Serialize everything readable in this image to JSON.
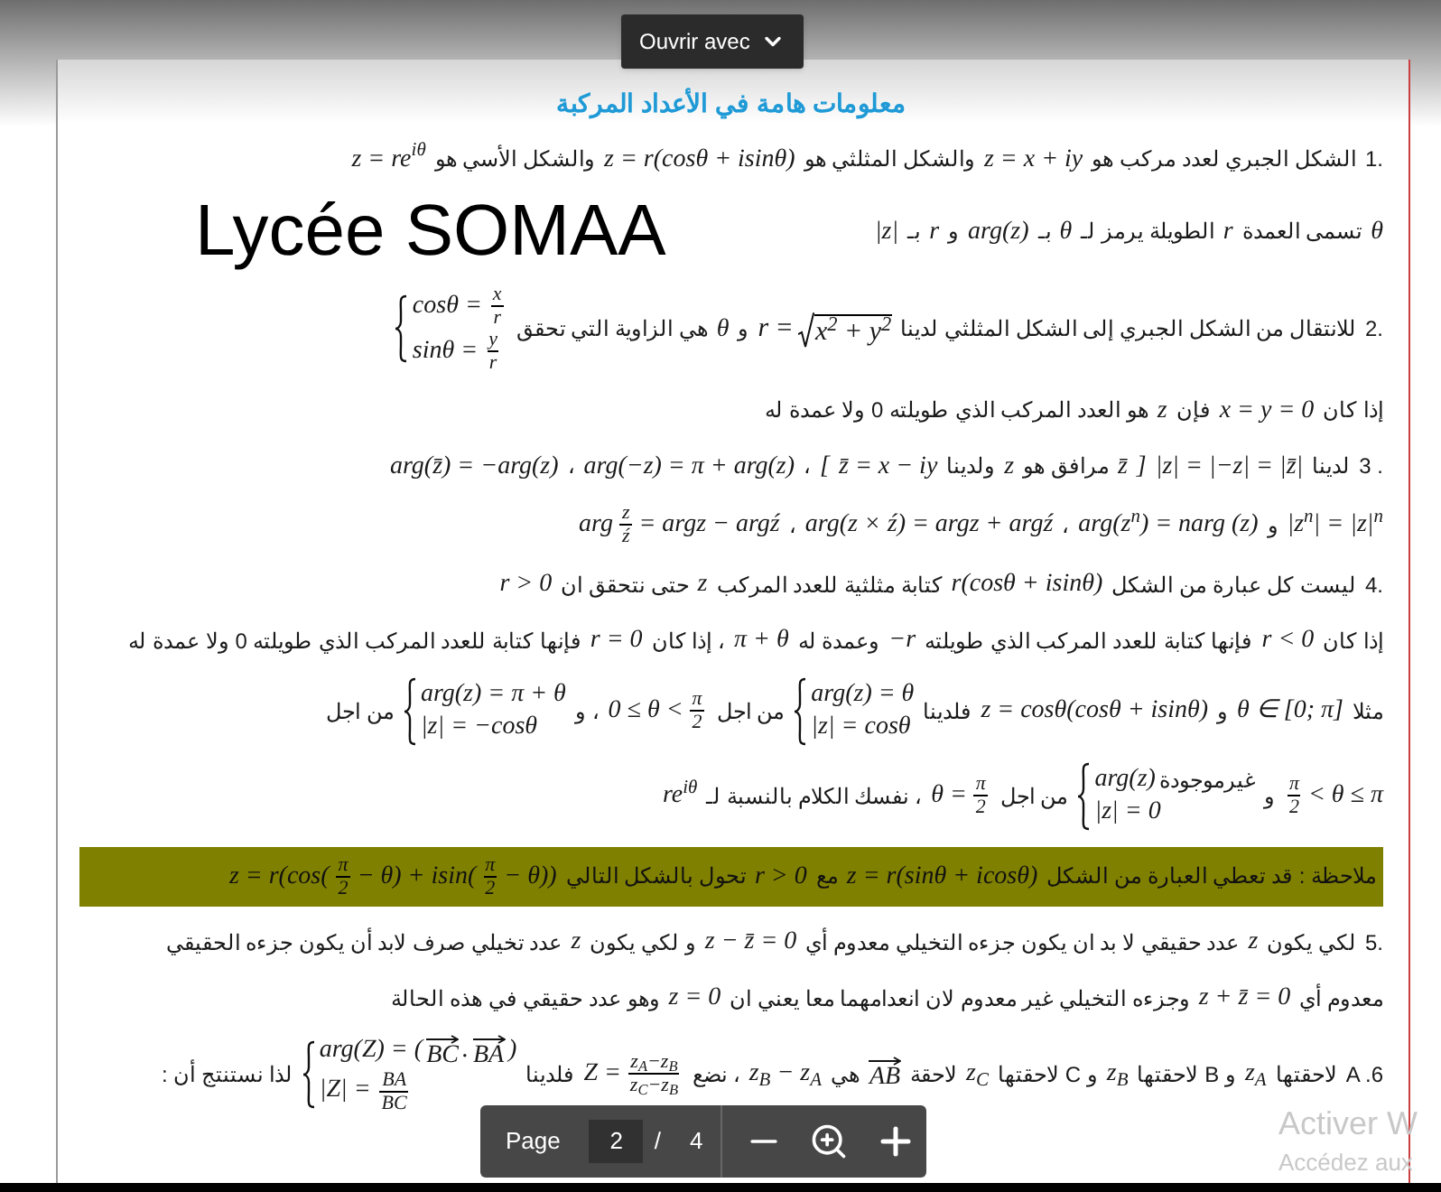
{
  "toolbar": {
    "open_with": "Ouvrir avec"
  },
  "document": {
    "lines": [
      {
        "kind": "title",
        "parts": [
          {
            "kind": "ar",
            "text": "معلومات هامة في الأعداد المركبة"
          }
        ]
      },
      {
        "kind": "para",
        "parts": [
          {
            "kind": "label",
            "text": "1."
          },
          {
            "kind": "ar",
            "text": "الشكل الجبري لعدد مركب هو"
          },
          {
            "kind": "math",
            "text": "z = x + iy"
          },
          {
            "kind": "ar",
            "text": "والشكل المثلثي هو"
          },
          {
            "kind": "math",
            "text": "z = r(cosθ + isinθ)"
          },
          {
            "kind": "ar",
            "text": "والشكل الأسي هو"
          },
          {
            "kind": "math",
            "text": "z = re$^{iθ}$"
          }
        ]
      },
      {
        "kind": "para",
        "aside": "Lycée SOMAA",
        "parts": [
          {
            "kind": "math",
            "text": "θ"
          },
          {
            "kind": "ar",
            "text": "تسمى العمدة"
          },
          {
            "kind": "math",
            "text": "r"
          },
          {
            "kind": "ar",
            "text": "الطويلة يرمز لـ"
          },
          {
            "kind": "math",
            "text": "θ"
          },
          {
            "kind": "ar",
            "text": "بـ"
          },
          {
            "kind": "math",
            "text": "arg(z)"
          },
          {
            "kind": "ar",
            "text": "و"
          },
          {
            "kind": "math",
            "text": "r"
          },
          {
            "kind": "ar",
            "text": "بـ"
          },
          {
            "kind": "math",
            "text": "|z|"
          }
        ]
      },
      {
        "kind": "para",
        "parts": [
          {
            "kind": "label",
            "text": "2."
          },
          {
            "kind": "ar",
            "text": "للانتقال من الشكل الجبري إلى الشكل المثلثي لدينا"
          },
          {
            "kind": "sqrt",
            "lhs": "r =",
            "radicand": "x$^{2}$ + y$^{2}$"
          },
          {
            "kind": "ar",
            "text": "و"
          },
          {
            "kind": "math",
            "text": "θ"
          },
          {
            "kind": "ar",
            "text": "هي الزاوية التي تحقق"
          },
          {
            "kind": "system",
            "rows": [
              [
                {
                  "kind": "frac",
                  "num": "x",
                  "den": "r"
                },
                {
                  "kind": "math",
                  "text": "cosθ ="
                }
              ],
              [
                {
                  "kind": "frac",
                  "num": "y",
                  "den": "r"
                },
                {
                  "kind": "math",
                  "text": "sinθ ="
                }
              ]
            ]
          }
        ]
      },
      {
        "kind": "para",
        "parts": [
          {
            "kind": "ar",
            "text": "إذا كان"
          },
          {
            "kind": "math",
            "text": "x = y = 0"
          },
          {
            "kind": "ar",
            "text": "فإن"
          },
          {
            "kind": "math",
            "text": "z"
          },
          {
            "kind": "ar",
            "text": "هو العدد المركب الذي طويلته 0 ولا عمدة له"
          }
        ]
      },
      {
        "kind": "para",
        "parts": [
          {
            "kind": "label",
            "text": "3 ."
          },
          {
            "kind": "ar",
            "text": "لدينا"
          },
          {
            "kind": "math",
            "text": "|z| = |−z| = |z̄|"
          },
          {
            "kind": "math",
            "text": "]"
          },
          {
            "kind": "math",
            "text": "z̄"
          },
          {
            "kind": "ar",
            "text": "مرافق هو"
          },
          {
            "kind": "math",
            "text": "z"
          },
          {
            "kind": "ar",
            "text": "ولدينا"
          },
          {
            "kind": "math",
            "text": "z̄ = x − iy"
          },
          {
            "kind": "math",
            "text": "["
          },
          {
            "kind": "ar",
            "text": "،"
          },
          {
            "kind": "math",
            "text": "arg(−z) = π + arg(z)"
          },
          {
            "kind": "ar",
            "text": "،"
          },
          {
            "kind": "math",
            "text": "arg(z̄) = −arg(z)"
          }
        ]
      },
      {
        "kind": "para",
        "parts": [
          {
            "kind": "math",
            "text": "|z$^{n}$| = |z|$^{n}$"
          },
          {
            "kind": "ar",
            "text": "و"
          },
          {
            "kind": "math",
            "text": "arg(z$^{n}$) = narg (z)"
          },
          {
            "kind": "ar",
            "text": "،"
          },
          {
            "kind": "math",
            "text": "arg(z × ź) = argz + argź"
          },
          {
            "kind": "ar",
            "text": "،"
          },
          {
            "kind": "expr",
            "items": [
              {
                "kind": "math",
                "text": "= argz − argź"
              },
              {
                "kind": "frac",
                "num": "z",
                "den": "ź"
              },
              {
                "kind": "math",
                "text": "arg"
              }
            ]
          }
        ]
      },
      {
        "kind": "para",
        "parts": [
          {
            "kind": "label",
            "text": "4."
          },
          {
            "kind": "ar",
            "text": "ليست كل عبارة من الشكل"
          },
          {
            "kind": "math",
            "text": "r(cosθ + isinθ)"
          },
          {
            "kind": "ar",
            "text": "كتابة مثلثية للعدد المركب"
          },
          {
            "kind": "math",
            "text": "z"
          },
          {
            "kind": "ar",
            "text": "حتى نتحقق ان"
          },
          {
            "kind": "math",
            "text": "r > 0"
          }
        ]
      },
      {
        "kind": "para",
        "parts": [
          {
            "kind": "ar",
            "text": "إذا كان"
          },
          {
            "kind": "math",
            "text": "r < 0"
          },
          {
            "kind": "ar",
            "text": "فإنها كتابة للعدد المركب الذي طويلته"
          },
          {
            "kind": "math",
            "text": "−r"
          },
          {
            "kind": "ar",
            "text": "وعمدة له"
          },
          {
            "kind": "math",
            "text": "π + θ"
          },
          {
            "kind": "ar",
            "text": "، إذا كان"
          },
          {
            "kind": "math",
            "text": "r = 0"
          },
          {
            "kind": "ar",
            "text": "فإنها كتابة للعدد المركب الذي طويلته 0 ولا عمدة له"
          }
        ]
      },
      {
        "kind": "para",
        "parts": [
          {
            "kind": "ar",
            "text": "مثلا"
          },
          {
            "kind": "math",
            "text": "θ ∈ [0; π]"
          },
          {
            "kind": "ar",
            "text": "و"
          },
          {
            "kind": "math",
            "text": "z = cosθ(cosθ + isinθ)"
          },
          {
            "kind": "ar",
            "text": "فلدينا"
          },
          {
            "kind": "system",
            "rows": [
              [
                {
                  "kind": "math",
                  "text": "arg(z) = θ"
                }
              ],
              [
                {
                  "kind": "math",
                  "text": "|z| = cosθ"
                }
              ]
            ]
          },
          {
            "kind": "ar",
            "text": "من اجل"
          },
          {
            "kind": "expr",
            "items": [
              {
                "kind": "frac",
                "num": "π",
                "den": "2"
              },
              {
                "kind": "math",
                "text": "0 ≤ θ <"
              }
            ]
          },
          {
            "kind": "ar",
            "text": "، و"
          },
          {
            "kind": "system",
            "rows": [
              [
                {
                  "kind": "math",
                  "text": "arg(z) = π + θ"
                }
              ],
              [
                {
                  "kind": "math",
                  "text": "|z| = −cosθ"
                }
              ]
            ]
          },
          {
            "kind": "ar",
            "text": "من اجل"
          }
        ]
      },
      {
        "kind": "para",
        "parts": [
          {
            "kind": "expr",
            "items": [
              {
                "kind": "math",
                "text": "< θ ≤ π"
              },
              {
                "kind": "frac",
                "num": "π",
                "den": "2"
              }
            ]
          },
          {
            "kind": "ar",
            "text": "و"
          },
          {
            "kind": "system",
            "rows": [
              [
                {
                  "kind": "expr",
                  "items": [
                    {
                      "kind": "ar",
                      "text": "غيرموجودة"
                    },
                    {
                      "kind": "math",
                      "text": "arg(z)"
                    }
                  ]
                }
              ],
              [
                {
                  "kind": "math",
                  "text": "|z| = 0"
                }
              ]
            ]
          },
          {
            "kind": "ar",
            "text": "من اجل"
          },
          {
            "kind": "expr",
            "items": [
              {
                "kind": "frac",
                "num": "π",
                "den": "2"
              },
              {
                "kind": "math",
                "text": "θ ="
              }
            ]
          },
          {
            "kind": "ar",
            "text": "، نفسك الكلام بالنسبة لـ"
          },
          {
            "kind": "math",
            "text": "re$^{iθ}$"
          }
        ]
      },
      {
        "kind": "note",
        "parts": [
          {
            "kind": "ar",
            "text": "ملاحظة : قد تعطي العبارة من الشكل"
          },
          {
            "kind": "math",
            "text": "z = r(sinθ + icosθ)"
          },
          {
            "kind": "ar",
            "text": "مع"
          },
          {
            "kind": "math",
            "text": "r > 0"
          },
          {
            "kind": "ar",
            "text": "تحول بالشكل التالي"
          },
          {
            "kind": "expr",
            "items": [
              {
                "kind": "math",
                "text": "− θ))"
              },
              {
                "kind": "frac",
                "num": "π",
                "den": "2"
              },
              {
                "kind": "math",
                "text": "− θ) + isin("
              },
              {
                "kind": "frac",
                "num": "π",
                "den": "2"
              },
              {
                "kind": "math",
                "text": "z = r(cos("
              }
            ]
          }
        ]
      },
      {
        "kind": "para",
        "parts": [
          {
            "kind": "label",
            "text": "5."
          },
          {
            "kind": "ar",
            "text": "لكي يكون"
          },
          {
            "kind": "math",
            "text": "z"
          },
          {
            "kind": "ar",
            "text": "عدد حقيقي لا بد ان يكون جزءه التخيلي معدوم أي"
          },
          {
            "kind": "math",
            "text": "z − z̄ = 0"
          },
          {
            "kind": "ar",
            "text": "و لكي يكون"
          },
          {
            "kind": "math",
            "text": "z"
          },
          {
            "kind": "ar",
            "text": "عدد تخيلي صرف لابد أن يكون جزءه الحقيقي"
          }
        ]
      },
      {
        "kind": "para",
        "parts": [
          {
            "kind": "ar",
            "text": "معدوم أي"
          },
          {
            "kind": "math",
            "text": "z + z̄ = 0"
          },
          {
            "kind": "ar",
            "text": "وجزءه التخيلي غير معدوم لان انعدامهما معا يعني ان"
          },
          {
            "kind": "math",
            "text": "z = 0"
          },
          {
            "kind": "ar",
            "text": "وهو عدد حقيقي في هذه الحالة"
          }
        ]
      },
      {
        "kind": "para",
        "parts": [
          {
            "kind": "label",
            "text": "A .6"
          },
          {
            "kind": "ar",
            "text": "لاحقتها"
          },
          {
            "kind": "math",
            "text": "z$_{A}$"
          },
          {
            "kind": "ar",
            "text": "و B لاحقتها"
          },
          {
            "kind": "math",
            "text": "z$_{B}$"
          },
          {
            "kind": "ar",
            "text": "و C لاحقتها"
          },
          {
            "kind": "math",
            "text": "z$_{C}$"
          },
          {
            "kind": "ar",
            "text": "لاحقة"
          },
          {
            "kind": "vec",
            "text": "AB"
          },
          {
            "kind": "ar",
            "text": "هي"
          },
          {
            "kind": "math",
            "text": "z$_{B}$ − z$_{A}$"
          },
          {
            "kind": "ar",
            "text": "، نضع"
          },
          {
            "kind": "expr",
            "items": [
              {
                "kind": "frac",
                "num": "z$_{A}$−z$_{B}$",
                "den": "z$_{C}$−z$_{B}$"
              },
              {
                "kind": "math",
                "text": "Z ="
              }
            ]
          },
          {
            "kind": "ar",
            "text": "فلدينا"
          },
          {
            "kind": "system",
            "rows": [
              [
                {
                  "kind": "expr",
                  "items": [
                    {
                      "kind": "math",
                      "text": ")"
                    },
                    {
                      "kind": "vec",
                      "text": "BA"
                    },
                    {
                      "kind": "math",
                      "text": "."
                    },
                    {
                      "kind": "vec",
                      "text": "BC"
                    },
                    {
                      "kind": "math",
                      "text": "arg(Z) = ("
                    }
                  ]
                }
              ],
              [
                {
                  "kind": "frac",
                  "num": "BA",
                  "den": "BC"
                },
                {
                  "kind": "math",
                  "text": "|Z| ="
                }
              ]
            ]
          },
          {
            "kind": "ar",
            "text": "لذا نستنتج أن :"
          }
        ]
      }
    ]
  },
  "page_controls": {
    "label": "Page",
    "current": "2",
    "separator": "/",
    "total": "4"
  },
  "os_watermark": [
    "Activer W",
    "Accédez aux"
  ]
}
